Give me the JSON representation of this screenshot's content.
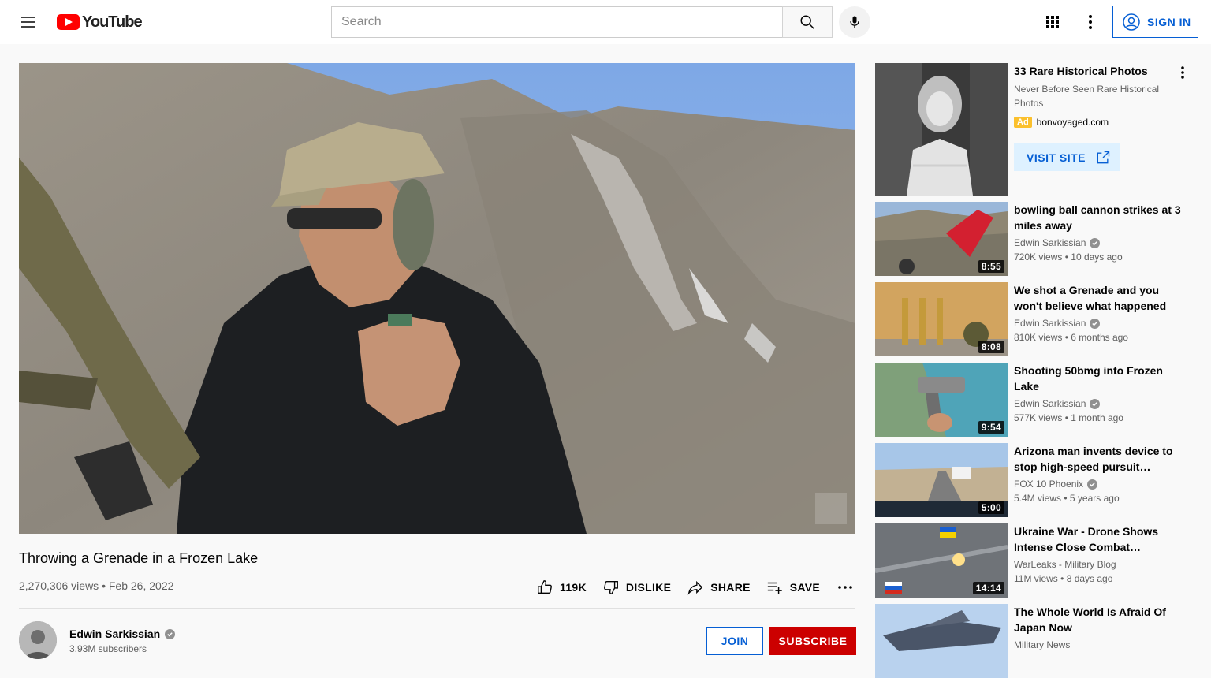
{
  "header": {
    "logo_text": "YouTube",
    "search_placeholder": "Search",
    "signin_label": "SIGN IN"
  },
  "video": {
    "title": "Throwing a Grenade in a Frozen Lake",
    "views": "2,270,306 views",
    "date": "Feb 26, 2022",
    "likes_label": "119K",
    "dislike_label": "DISLIKE",
    "share_label": "SHARE",
    "save_label": "SAVE"
  },
  "owner": {
    "name": "Edwin Sarkissian",
    "subscribers": "3.93M subscribers",
    "join_label": "JOIN",
    "subscribe_label": "SUBSCRIBE"
  },
  "ad": {
    "title": "33 Rare Historical Photos",
    "description": "Never Before Seen Rare Historical Photos",
    "badge": "Ad",
    "domain": "bonvoyaged.com",
    "visit_label": "VISIT SITE"
  },
  "recommendations": [
    {
      "title": "bowling ball cannon strikes at 3 miles away",
      "channel": "Edwin Sarkissian",
      "verified": true,
      "views": "720K views",
      "age": "10 days ago",
      "duration": "8:55"
    },
    {
      "title": "We shot a Grenade and you won't believe what happened",
      "channel": "Edwin Sarkissian",
      "verified": true,
      "views": "810K views",
      "age": "6 months ago",
      "duration": "8:08"
    },
    {
      "title": "Shooting 50bmg into Frozen Lake",
      "channel": "Edwin Sarkissian",
      "verified": true,
      "views": "577K views",
      "age": "1 month ago",
      "duration": "9:54"
    },
    {
      "title": "Arizona man invents device to stop high-speed pursuit…",
      "channel": "FOX 10 Phoenix",
      "verified": true,
      "views": "5.4M views",
      "age": "5 years ago",
      "duration": "5:00"
    },
    {
      "title": " Ukraine War - Drone Shows Intense Close Combat Betwee…",
      "channel": "WarLeaks - Military Blog",
      "verified": false,
      "views": "11M views",
      "age": "8 days ago",
      "duration": "14:14"
    },
    {
      "title": "The Whole World Is Afraid Of Japan Now",
      "channel": "Military News",
      "verified": false,
      "views": "",
      "age": "",
      "duration": ""
    }
  ],
  "separator": "•",
  "colors": {
    "brand_red": "#ff0000",
    "link_blue": "#065fd4",
    "subscribe_red": "#cc0000",
    "ad_yellow": "#fbc02d"
  }
}
